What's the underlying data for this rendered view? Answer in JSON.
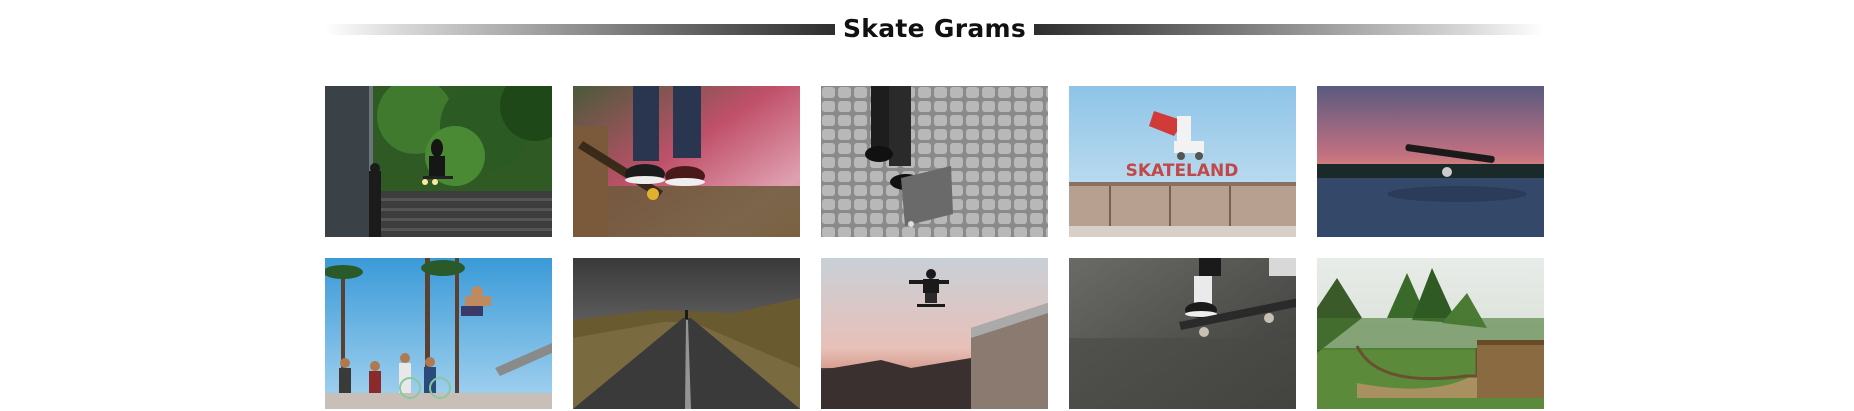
{
  "header": {
    "title": "Skate Grams"
  },
  "gallery": {
    "photos": [
      {
        "subject": "skater jumping stairs under trees"
      },
      {
        "subject": "sneakers on skateboard against pink wall"
      },
      {
        "subject": "black and white skater on cobblestones"
      },
      {
        "subject": "Skateland sign with roller skate",
        "sign_text": "SKATELAND"
      },
      {
        "subject": "skateboard on car roof at sunset"
      },
      {
        "subject": "skater jumping over crowd by palm trees"
      },
      {
        "subject": "empty road through hills under storm clouds"
      },
      {
        "subject": "skater airborne over ramp at dusk"
      },
      {
        "subject": "sneaker kicking up skateboard"
      },
      {
        "subject": "wooden half-pipe in green field"
      }
    ]
  }
}
